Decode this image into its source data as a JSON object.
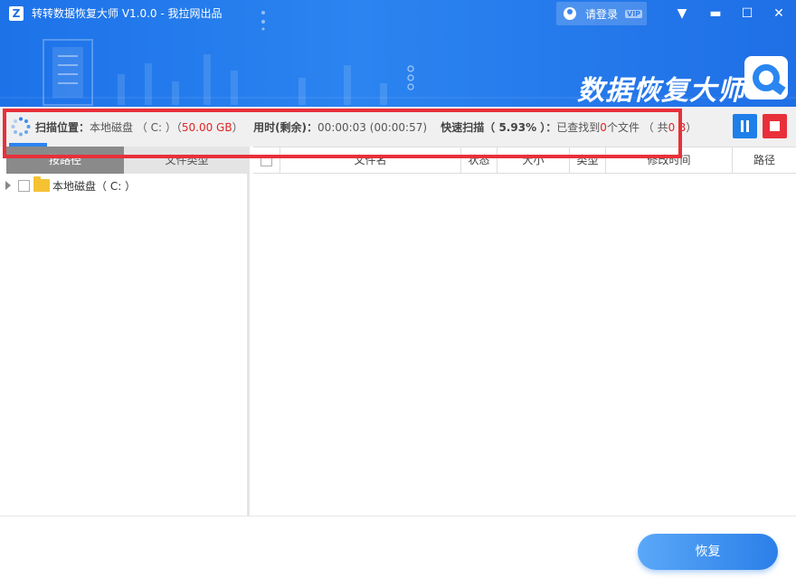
{
  "window": {
    "logo_letter": "Z",
    "title": "转转数据恢复大师 V1.0.0 - 我拉网出品",
    "login_label": "请登录",
    "vip_badge": "VIP",
    "min_glyph": "▬",
    "max_glyph": "☐",
    "close_glyph": "✕",
    "menu_glyph": "▼"
  },
  "banner": {
    "brand_text": "数据恢复大师"
  },
  "scan": {
    "location_label": "扫描位置：",
    "location_value": "本地磁盘 （ C: ）（",
    "disk_size": "50.00 GB",
    "disk_size_close": "）",
    "time_label": "用时(剩余)：",
    "time_value": "00:00:03 (00:00:57)",
    "mode_label": "快速扫描（ 5.93% ）：",
    "found_prefix": "已查找到",
    "found_count": "0",
    "found_suffix": "个文件 （ 共",
    "found_size": "0 B",
    "found_close": "）",
    "progress_percent": 5.93
  },
  "left_panel": {
    "tabs": [
      "按路径",
      "文件类型"
    ],
    "tree": [
      {
        "label": "本地磁盘（ C: ）"
      }
    ]
  },
  "table": {
    "columns": [
      "文件名",
      "状态",
      "大小",
      "类型",
      "修改时间",
      "路径"
    ]
  },
  "footer": {
    "recover_label": "恢复"
  },
  "colors": {
    "brand_blue": "#1f72e8",
    "highlight_red": "#e8303a",
    "accent_red_text": "#e02424"
  }
}
